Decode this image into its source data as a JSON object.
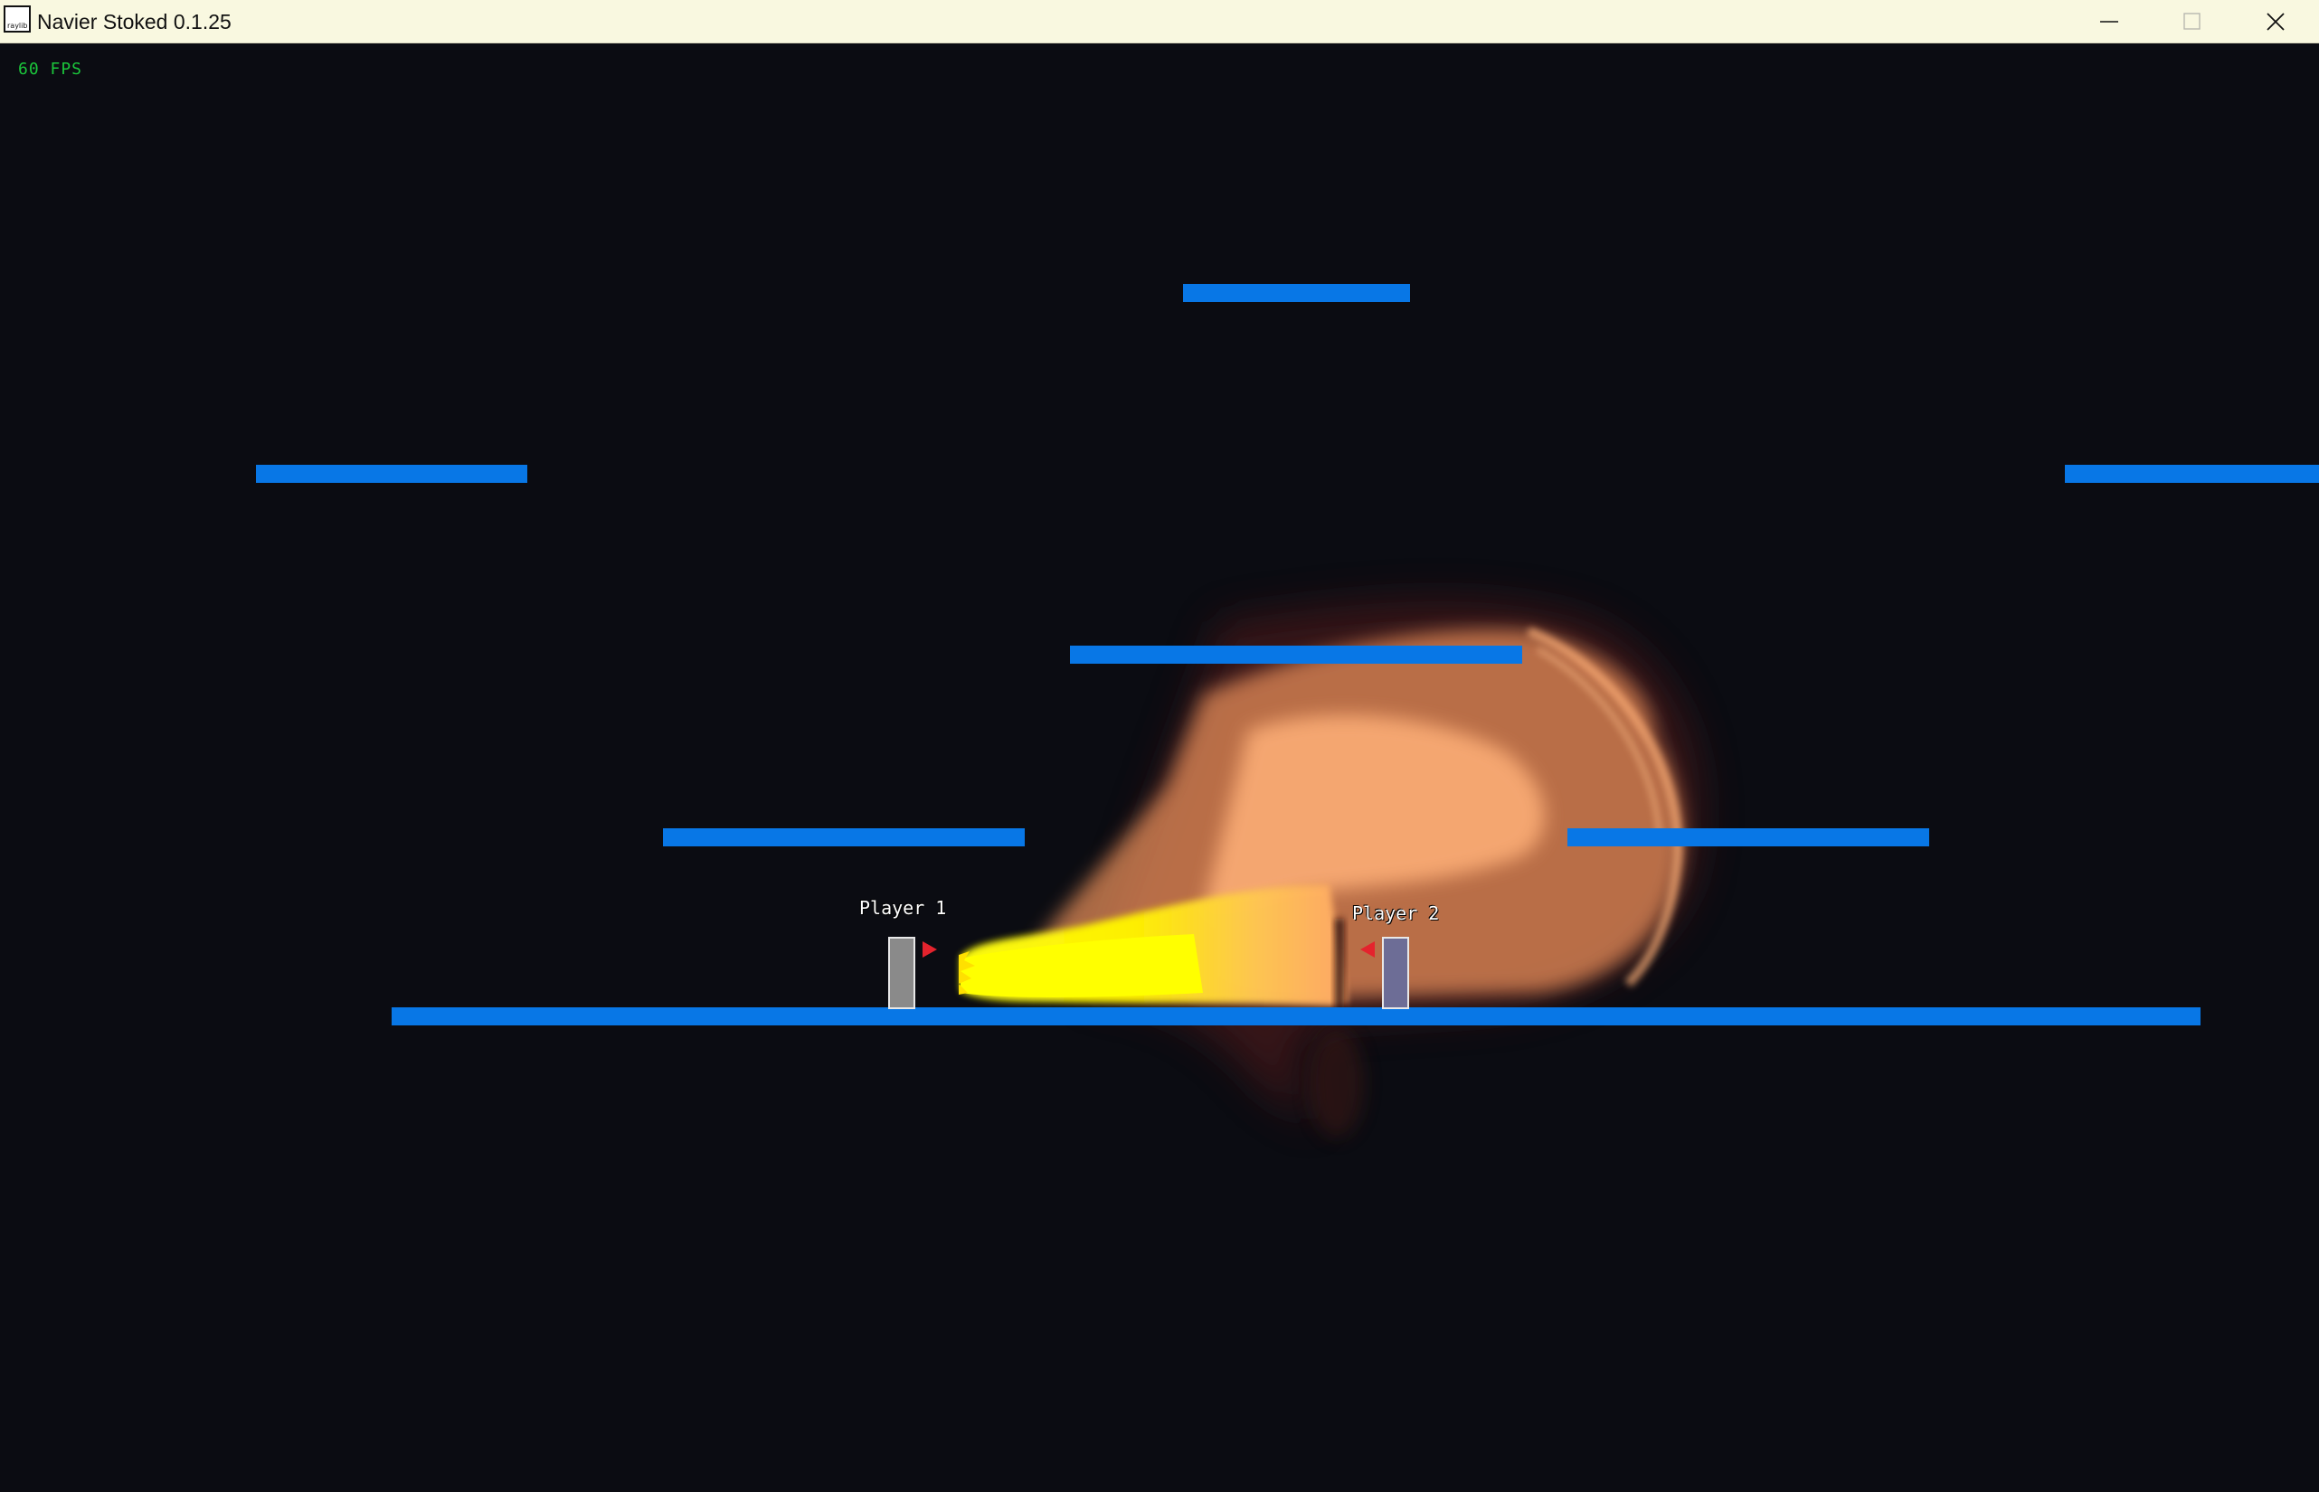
{
  "window": {
    "title": "Navier Stoked 0.1.25",
    "icon_label": "raylib"
  },
  "hud": {
    "fps": "60 FPS"
  },
  "players": [
    {
      "label": "Player 1",
      "facing": "right"
    },
    {
      "label": "Player 2",
      "facing": "left"
    }
  ],
  "colors": {
    "platform": "#0877e6",
    "fps_text": "#1bc63b",
    "background": "#0b0c12",
    "arrow": "#e4232d",
    "fire_core": "#ffff00",
    "fire_outer": "#ffa860"
  },
  "icons": {
    "minimize": "minimize-icon",
    "maximize": "maximize-icon",
    "close": "close-icon"
  }
}
